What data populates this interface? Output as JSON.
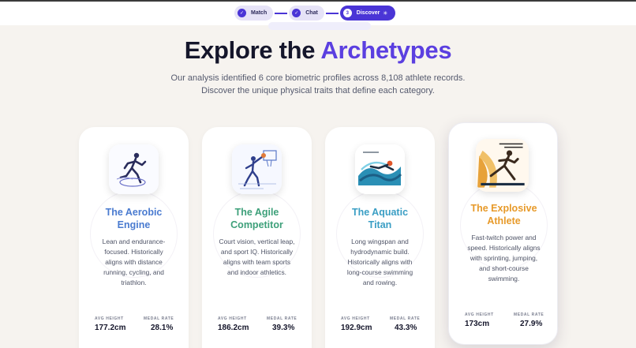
{
  "stepper": {
    "steps": [
      {
        "label": "Match",
        "bullet": "✓"
      },
      {
        "label": "Chat",
        "bullet": "✓"
      },
      {
        "label": "Discover",
        "bullet": "3",
        "sparkle": "✳"
      }
    ]
  },
  "hero": {
    "title_main": "Explore the ",
    "title_accent": "Archetypes",
    "subtitle_line1": "Our analysis identified 6 core biometric profiles across 8,108 athlete records.",
    "subtitle_line2": "Discover the unique physical traits that define each category."
  },
  "stat_labels": {
    "height": "AVG HEIGHT",
    "medal": "MEDAL RATE"
  },
  "cards": [
    {
      "name_line1": "The Aerobic",
      "name_line2": "Engine",
      "color": "#4a7bd0",
      "desc": [
        "Lean and endurance-",
        "focused. Historically",
        "aligns with distance",
        "running, cycling, and",
        "triathlon."
      ],
      "avg_height": "177.2cm",
      "medal_rate": "28.1%",
      "icon": "runner-icon"
    },
    {
      "name_line1": "The Agile",
      "name_line2": "Competitor",
      "color": "#3ea07a",
      "desc": [
        "Court vision, vertical leap,",
        "and sport IQ. Historically",
        "aligns with team sports",
        "and indoor athletics."
      ],
      "avg_height": "186.2cm",
      "medal_rate": "39.3%",
      "icon": "basketball-player-icon"
    },
    {
      "name_line1": "The Aquatic",
      "name_line2": "Titan",
      "color": "#3a9ec4",
      "desc": [
        "Long wingspan and",
        "hydrodynamic build.",
        "Historically aligns with",
        "long-course swimming",
        "and rowing."
      ],
      "avg_height": "192.9cm",
      "medal_rate": "43.3%",
      "icon": "swimmer-icon"
    },
    {
      "name_line1": "The Explosive",
      "name_line2": "Athlete",
      "color": "#e79a2a",
      "desc": [
        "Fast-twitch power and",
        "speed. Historically aligns",
        "with sprinting, jumping,",
        "and short-course",
        "swimming."
      ],
      "avg_height": "173cm",
      "medal_rate": "27.9%",
      "icon": "sprinter-icon"
    }
  ]
}
